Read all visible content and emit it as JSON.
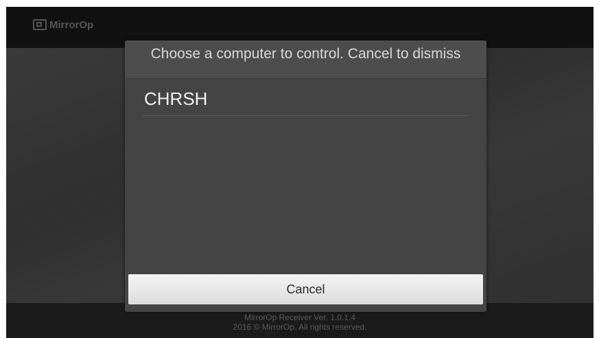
{
  "app": {
    "logo_text": "MirrorOp"
  },
  "dialog": {
    "title": "Choose a computer to control. Cancel to dismiss",
    "computers": [
      "CHRSH"
    ],
    "cancel_label": "Cancel"
  },
  "footer": {
    "version": "MirrorOp Receiver Ver. 1.0.1.4",
    "copyright": "2016 © MirrorOp. All rights reserved."
  }
}
